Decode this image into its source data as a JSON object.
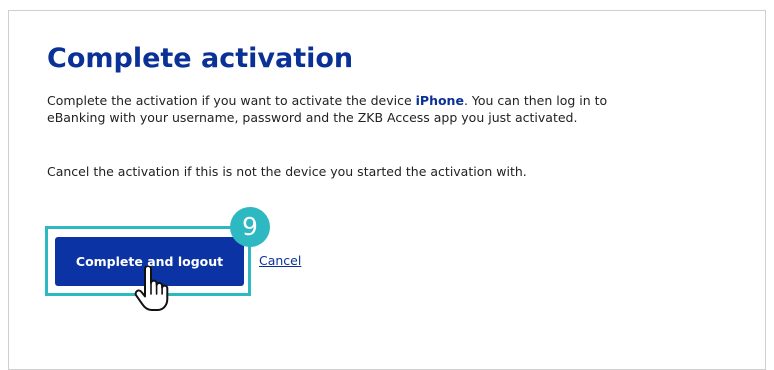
{
  "dialog": {
    "title": "Complete activation",
    "para1_before": "Complete the activation if you want to activate the device ",
    "device_name": "iPhone",
    "para1_after": ". You can then log in to eBanking with your username, password and the ZKB Access app you just activated.",
    "para2": "Cancel the activation if this is not the device you started the activation with.",
    "primary_button_label": "Complete and logout",
    "cancel_link_label": "Cancel"
  },
  "annotation": {
    "step_number": "9",
    "accent_color": "#2eb8c2",
    "cursor_icon": "hand-pointer-icon"
  },
  "colors": {
    "brand_blue": "#0c33a3",
    "heading_blue": "#0a3296"
  }
}
